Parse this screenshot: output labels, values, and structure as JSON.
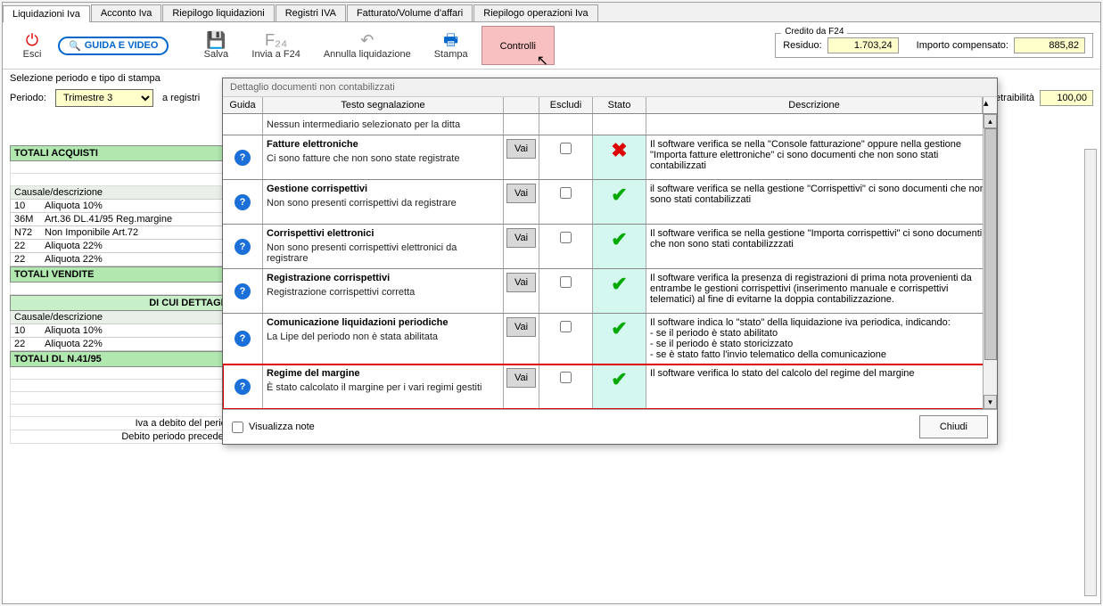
{
  "tabs": [
    "Liquidazioni Iva",
    "Acconto Iva",
    "Riepilogo liquidazioni",
    "Registri IVA",
    "Fatturato/Volume d'affari",
    "Riepilogo operazioni Iva"
  ],
  "toolbar": {
    "esci": "Esci",
    "guida_video": "GUIDA E VIDEO",
    "salva": "Salva",
    "invia_f24": "Invia a F24",
    "annulla": "Annulla liquidazione",
    "stampa": "Stampa",
    "controlli": "Controlli"
  },
  "credito": {
    "legend": "Credito da F24",
    "residuo_label": "Residuo:",
    "residuo_val": "1.703,24",
    "importo_label": "Importo compensato:",
    "importo_val": "885,82"
  },
  "sel": {
    "title": "Selezione periodo e tipo di stampa",
    "periodo_label": "Periodo:",
    "periodo_val": "Trimestre 3",
    "a_registri": "a registri",
    "detr_label": "detraibilità",
    "detr_val": "100,00"
  },
  "bg": {
    "tot_acquisti": "TOTALI ACQUISTI",
    "causale": "Causale/descrizione",
    "rows_acq": [
      {
        "c1": "10",
        "c2": "Aliquota 10%"
      },
      {
        "c1": "36M",
        "c2": "Art.36 DL.41/95 Reg.margine"
      },
      {
        "c1": "N72",
        "c2": "Non Imponibile Art.72"
      },
      {
        "c1": "22",
        "c2": "Aliquota 22%"
      },
      {
        "c1": "22",
        "c2": "Aliquota 22%"
      }
    ],
    "tot_vendite": "TOTALI VENDITE",
    "di_cui": "DI CUI DETTAGLIO",
    "rows_det": [
      {
        "c1": "10",
        "c2": "Aliquota 10%"
      },
      {
        "c1": "22",
        "c2": "Aliquota 22%"
      }
    ],
    "tot_dl": "TOTALI DL N.41/95",
    "iva_debito": "Iva a debito del periodo",
    "debito_prec": "Debito periodo precedente"
  },
  "dialog": {
    "title": "Dettaglio documenti non contabilizzati",
    "headers": {
      "guida": "Guida",
      "testo": "Testo segnalazione",
      "escludi": "Escludi",
      "stato": "Stato",
      "descrizione": "Descrizione"
    },
    "vai": "Vai",
    "first_row": "Nessun intermediario selezionato per la ditta",
    "rows": [
      {
        "title": "Fatture elettroniche",
        "sub": "Ci sono fatture che non sono state registrate",
        "stato": "bad",
        "desc": "Il software verifica se nella \"Console fatturazione\" oppure nella gestione \"Importa fatture elettroniche\" ci sono documenti che non sono stati contabilizzati"
      },
      {
        "title": "Gestione corrispettivi",
        "sub": "Non sono presenti corrispettivi da registrare",
        "stato": "ok",
        "desc": "il software verifica se nella gestione \"Corrispettivi\" ci sono documenti che non sono stati contabilizzati"
      },
      {
        "title": "Corrispettivi elettronici",
        "sub": "Non sono presenti corrispettivi elettronici da registrare",
        "stato": "ok",
        "desc": "Il software verifica se nella gestione \"Importa corrispettivi\" ci sono documenti che non sono stati contabilizzzati"
      },
      {
        "title": "Registrazione corrispettivi",
        "sub": "Registrazione corrispettivi corretta",
        "stato": "ok",
        "desc": "Il software verifica la presenza di registrazioni di prima nota provenienti da entrambe le gestioni corrispettivi (inserimento manuale e corrispettivi telematici) al fine di evitarne la doppia contabilizzazione."
      },
      {
        "title": "Comunicazione liquidazioni periodiche",
        "sub": "La Lipe del periodo non è stata abilitata",
        "stato": "ok",
        "desc": "Il software indica lo \"stato\" della liquidazione iva periodica, indicando:\n- se il periodo è stato abilitato\n- se il periodo è stato storicizzato\n- se è stato fatto l'invio telematico della comunicazione"
      },
      {
        "title": "Regime del margine",
        "sub": "È stato calcolato il margine per i vari regimi gestiti",
        "stato": "ok",
        "desc": "Il software verifica lo stato del calcolo del regime del margine",
        "highlight": true
      }
    ],
    "visualizza_note": "Visualizza note",
    "chiudi": "Chiudi"
  }
}
